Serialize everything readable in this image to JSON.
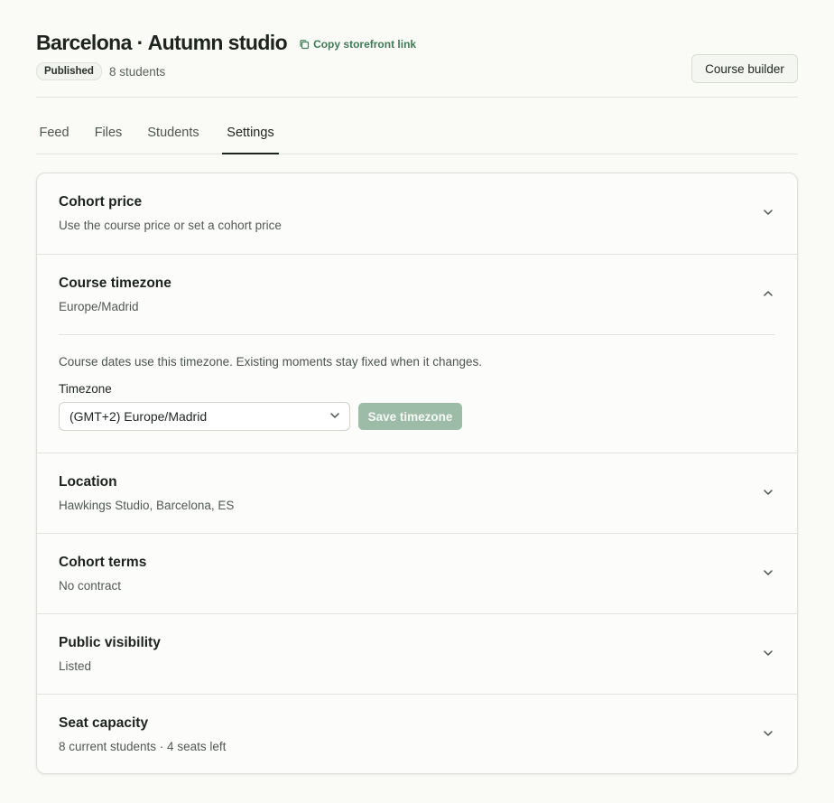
{
  "header": {
    "title": "Barcelona · Autumn studio",
    "copy_link_label": "Copy storefront link",
    "status_badge": "Published",
    "students_count": "8 students",
    "course_builder_label": "Course builder"
  },
  "tabs": [
    {
      "label": "Feed",
      "active": false
    },
    {
      "label": "Files",
      "active": false
    },
    {
      "label": "Students",
      "active": false
    },
    {
      "label": "Settings",
      "active": true
    }
  ],
  "settings": {
    "cohort_price": {
      "title": "Cohort price",
      "subtitle": "Use the course price or set a cohort price",
      "expanded": false
    },
    "course_timezone": {
      "title": "Course timezone",
      "subtitle": "Europe/Madrid",
      "expanded": true,
      "note": "Course dates use this timezone. Existing moments stay fixed when it changes.",
      "field_label": "Timezone",
      "selected_value": "(GMT+2) Europe/Madrid",
      "save_label": "Save timezone"
    },
    "location": {
      "title": "Location",
      "subtitle": "Hawkings Studio, Barcelona, ES",
      "expanded": false
    },
    "cohort_terms": {
      "title": "Cohort terms",
      "subtitle": "No contract",
      "expanded": false
    },
    "public_visibility": {
      "title": "Public visibility",
      "subtitle": "Listed",
      "expanded": false
    },
    "seat_capacity": {
      "title": "Seat capacity",
      "subtitle": "8 current students · 4 seats left",
      "expanded": false
    }
  },
  "icons": {
    "copy": "copy-icon",
    "chevron_down": "chevron-down-icon",
    "chevron_up": "chevron-up-icon"
  },
  "colors": {
    "accent": "#3f7a57",
    "save_button_disabled": "#9cbca8",
    "background": "#fafbf7"
  }
}
